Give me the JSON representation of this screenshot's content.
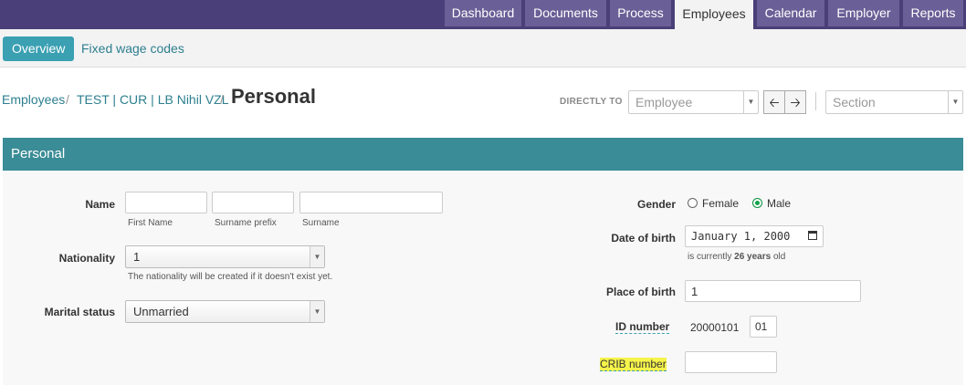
{
  "top_nav": {
    "tabs": [
      {
        "label": "Dashboard",
        "active": false
      },
      {
        "label": "Documents",
        "active": false
      },
      {
        "label": "Process",
        "active": false
      },
      {
        "label": "Employees",
        "active": true
      },
      {
        "label": "Calendar",
        "active": false
      },
      {
        "label": "Employer",
        "active": false
      },
      {
        "label": "Reports",
        "active": false
      }
    ]
  },
  "sub_nav": {
    "overview": "Overview",
    "fixed_wage_codes": "Fixed wage codes"
  },
  "breadcrumb": {
    "items": [
      "Employees",
      "TEST | CUR | LB Nihil VZL"
    ],
    "separator": "/",
    "title": "Personal"
  },
  "directly_to": {
    "label": "DIRECTLY TO",
    "employee_placeholder": "Employee",
    "section_placeholder": "Section"
  },
  "panel": {
    "title": "Personal",
    "name": {
      "label": "Name",
      "first_name_hint": "First Name",
      "surname_prefix_hint": "Surname prefix",
      "surname_hint": "Surname",
      "first_name_value": "",
      "surname_prefix_value": "",
      "surname_value": ""
    },
    "nationality": {
      "label": "Nationality",
      "value": "1",
      "help": "The nationality will be created if it doesn't exist yet."
    },
    "marital_status": {
      "label": "Marital status",
      "value": "Unmarried"
    },
    "gender": {
      "label": "Gender",
      "options": [
        "Female",
        "Male"
      ],
      "selected": "Male"
    },
    "date_of_birth": {
      "label": "Date of birth",
      "value": "January 1, 2000",
      "help_prefix": "is currently",
      "help_age": "26 years",
      "help_suffix": "old"
    },
    "place_of_birth": {
      "label": "Place of birth",
      "value": "1"
    },
    "id_number": {
      "label": "ID number",
      "prefix": "20000101",
      "suffix_value": "01"
    },
    "crib_number": {
      "label": "CRIB number",
      "value": ""
    }
  },
  "colors": {
    "topbar": "#4a3f78",
    "tab": "#6a5f96",
    "accent": "#3aa0b2",
    "panel_header": "#3a8c96",
    "highlight": "#f6f34a"
  }
}
